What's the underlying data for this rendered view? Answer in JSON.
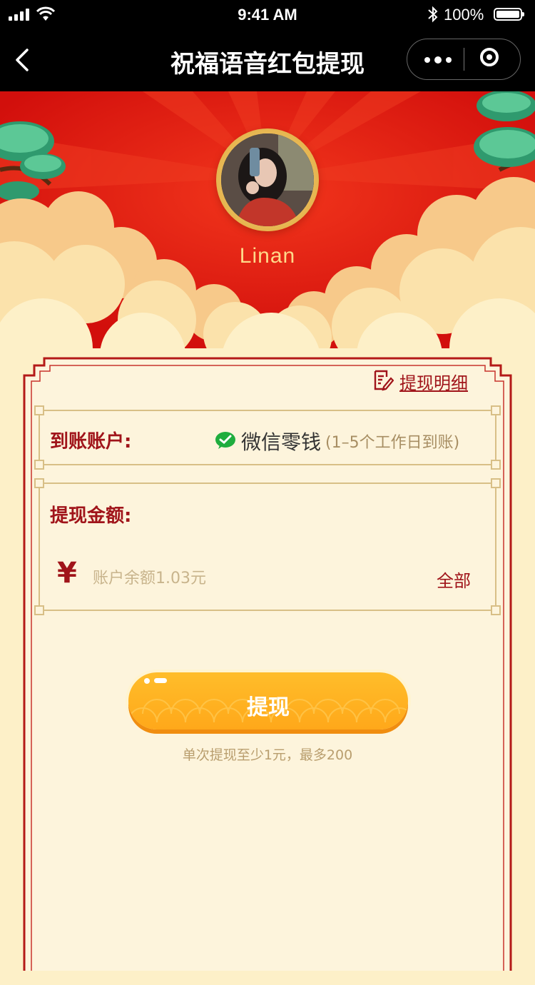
{
  "status_bar": {
    "time": "9:41 AM",
    "battery": "100%"
  },
  "nav": {
    "title": "祝福语音红包提现"
  },
  "profile": {
    "username": "Linan"
  },
  "detail_link": {
    "label": "提现明细"
  },
  "account": {
    "label": "到账账户:",
    "name": "微信零钱",
    "arrival": "(1–5个工作日到账)"
  },
  "amount": {
    "label": "提现金额:",
    "currency": "¥",
    "placeholder": "账户余额1.03元",
    "all_label": "全部"
  },
  "submit": {
    "label": "提现",
    "hint": "单次提现至少1元，最多200"
  },
  "colors": {
    "accent_red": "#a0141a",
    "hero_red": "#e11a12",
    "button_orange": "#ffa81a",
    "bg_cream": "#fdf0c8"
  }
}
